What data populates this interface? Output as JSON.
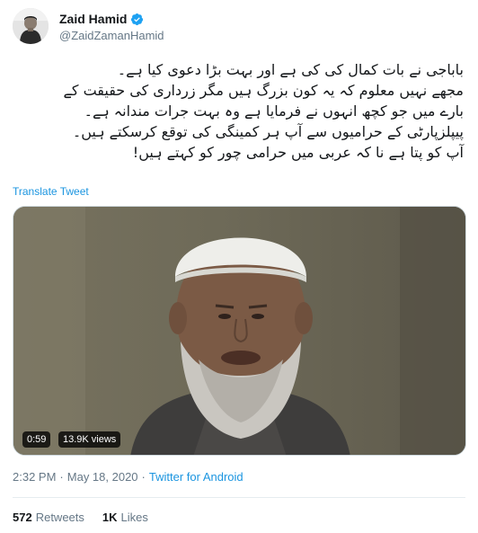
{
  "author": {
    "display_name": "Zaid Hamid",
    "handle": "@ZaidZamanHamid"
  },
  "tweet": {
    "lines": [
      "باباجی نے بات کمال کی کی ہے اور بہت بڑا دعوی کیا ہے۔",
      "مجھے نہیں معلوم کہ یہ کون بزرگ ہیں مگر زرداری کی حقیقت کے",
      "بارے میں جو کچھ انہوں نے فرمایا ہے وہ بہت جرات مندانہ ہے۔",
      "پیپلزپارٹی کے حرامیوں سے آپ ہر کمینگی کی  توقع کرسکتے ہیں۔",
      "آپ کو پتا ہے نا کہ عربی میں حرامی چور کو کہتے ہیں!"
    ],
    "translate_label": "Translate Tweet"
  },
  "video": {
    "duration": "0:59",
    "views": "13.9K views"
  },
  "meta": {
    "time": "2:32 PM",
    "separator": "·",
    "date": "May 18, 2020",
    "source": "Twitter for Android"
  },
  "stats": {
    "retweets_count": "572",
    "retweets_label": "Retweets",
    "likes_count": "1K",
    "likes_label": "Likes"
  },
  "colors": {
    "link": "#1b95e0",
    "secondary_text": "#657786",
    "verified": "#1da1f2"
  }
}
